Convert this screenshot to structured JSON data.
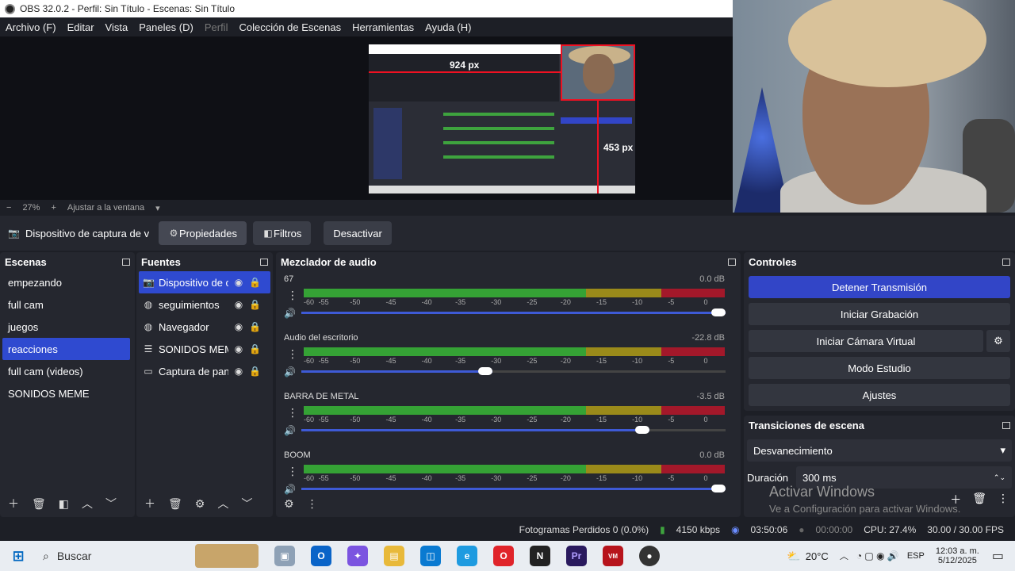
{
  "window": {
    "title": "OBS 32.0.2 - Perfil: Sin Título - Escenas: Sin Título"
  },
  "menu": [
    {
      "label": "Archivo (F)",
      "enabled": true
    },
    {
      "label": "Editar",
      "enabled": true
    },
    {
      "label": "Vista",
      "enabled": true
    },
    {
      "label": "Paneles (D)",
      "enabled": true
    },
    {
      "label": "Perfil",
      "enabled": false
    },
    {
      "label": "Colección de Escenas",
      "enabled": true
    },
    {
      "label": "Herramientas",
      "enabled": true
    },
    {
      "label": "Ayuda (H)",
      "enabled": true
    }
  ],
  "preview": {
    "label_top": "924 px",
    "label_right": "453 px"
  },
  "zoom": {
    "level": "27%",
    "fit_label": "Ajustar a la ventana"
  },
  "source_toolbar": {
    "source_name": "Dispositivo de captura de v",
    "properties": "Propiedades",
    "filters": "Filtros",
    "deactivate": "Desactivar"
  },
  "scenes": {
    "title": "Escenas",
    "items": [
      "empezando",
      "full cam",
      "juegos",
      "reacciones",
      "full cam (videos)",
      "SONIDOS MEME"
    ],
    "selected": "reacciones"
  },
  "sources": {
    "title": "Fuentes",
    "items": [
      {
        "label": "Dispositivo de c",
        "icon": "camera-icon"
      },
      {
        "label": "seguimientos",
        "icon": "globe-icon"
      },
      {
        "label": "Navegador",
        "icon": "globe-icon"
      },
      {
        "label": "SONIDOS MEM",
        "icon": "list-icon"
      },
      {
        "label": "Captura de pan",
        "icon": "monitor-icon"
      }
    ]
  },
  "mixer": {
    "title": "Mezclador de audio",
    "scale": [
      "-60",
      "-55",
      "-50",
      "-45",
      "-40",
      "-35",
      "-30",
      "-25",
      "-20",
      "-15",
      "-10",
      "-5",
      "0"
    ],
    "channels": [
      {
        "name": "67",
        "db": "0.0 dB",
        "volume": 1.0
      },
      {
        "name": "Audio del escritorio",
        "db": "-22.8 dB",
        "volume": 0.45
      },
      {
        "name": "BARRA DE METAL",
        "db": "-3.5 dB",
        "volume": 0.82
      },
      {
        "name": "BOOM",
        "db": "0.0 dB",
        "volume": 1.0
      }
    ]
  },
  "controls": {
    "title": "Controles",
    "stop_stream": "Detener Transmisión",
    "start_recording": "Iniciar Grabación",
    "start_virtual_cam": "Iniciar Cámara Virtual",
    "studio_mode": "Modo Estudio",
    "settings": "Ajustes"
  },
  "transitions": {
    "title": "Transiciones de escena",
    "selected": "Desvanecimiento",
    "duration_label": "Duración",
    "duration_value": "300 ms"
  },
  "watermark": {
    "line1": "Activar Windows",
    "line2": "Ve a Configuración para activar Windows."
  },
  "status": {
    "dropped": "Fotogramas Perdidos 0 (0.0%)",
    "bitrate": "4150 kbps",
    "stream_time": "03:50:06",
    "rec_time": "00:00:00",
    "cpu": "CPU: 27.4%",
    "fps": "30.00 / 30.00 FPS"
  },
  "taskbar": {
    "search_placeholder": "Buscar",
    "weather": "20°C",
    "lang": "ESP",
    "time": "12:03 a. m.",
    "date": "5/12/2025"
  }
}
